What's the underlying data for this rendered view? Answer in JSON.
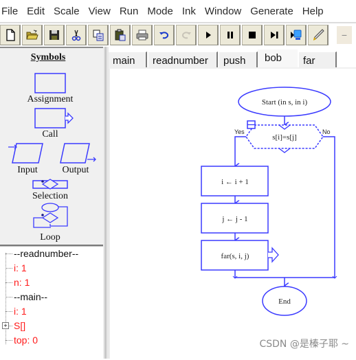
{
  "menu": [
    "File",
    "Edit",
    "Scale",
    "View",
    "Run",
    "Mode",
    "Ink",
    "Window",
    "Generate",
    "Help"
  ],
  "toolbar": [
    {
      "name": "new",
      "icon": "new-file-icon"
    },
    {
      "name": "open",
      "icon": "open-folder-icon"
    },
    {
      "name": "save",
      "icon": "save-icon"
    },
    {
      "name": "cut",
      "icon": "cut-icon"
    },
    {
      "name": "copy",
      "icon": "copy-icon"
    },
    {
      "name": "paste",
      "icon": "paste-icon"
    },
    {
      "name": "print",
      "icon": "print-icon"
    },
    {
      "name": "undo",
      "icon": "undo-icon"
    },
    {
      "name": "redo",
      "icon": "redo-icon",
      "disabled": true
    },
    {
      "name": "run",
      "icon": "play-icon"
    },
    {
      "name": "pause",
      "icon": "pause-icon"
    },
    {
      "name": "stop",
      "icon": "stop-icon"
    },
    {
      "name": "step",
      "icon": "step-icon"
    },
    {
      "name": "step-into",
      "icon": "step-into-icon"
    },
    {
      "name": "ink",
      "icon": "pen-icon"
    }
  ],
  "symbols": {
    "title": "Symbols",
    "items": [
      "Assignment",
      "Call",
      "Input",
      "Output",
      "Selection",
      "Loop"
    ]
  },
  "variables": [
    {
      "text": "--readnumber--",
      "color": "black"
    },
    {
      "text": "i: 1",
      "color": "red"
    },
    {
      "text": "n: 1",
      "color": "red"
    },
    {
      "text": "--main--",
      "color": "black"
    },
    {
      "text": "i: 1",
      "color": "red"
    },
    {
      "text": "S[]",
      "color": "red",
      "expandable": true
    },
    {
      "text": "top: 0",
      "color": "red"
    }
  ],
  "tabs": [
    {
      "label": "main",
      "active": false
    },
    {
      "label": "readnumber",
      "active": false
    },
    {
      "label": "push",
      "active": false
    },
    {
      "label": "bob",
      "active": true
    },
    {
      "label": "far",
      "active": false
    }
  ],
  "flowchart": {
    "start": "Start (in s, in i)",
    "condition": "s[i]=s[j]",
    "yes_label": "Yes",
    "no_label": "No",
    "step1": "i ← i + 1",
    "step2": "j ← j - 1",
    "call": "far(s, i, j)",
    "end": "End"
  },
  "colors": {
    "flow_stroke": "#3a3aff",
    "var_red": "#ff1a1a"
  },
  "watermark": "CSDN @是榛子耶 ~"
}
